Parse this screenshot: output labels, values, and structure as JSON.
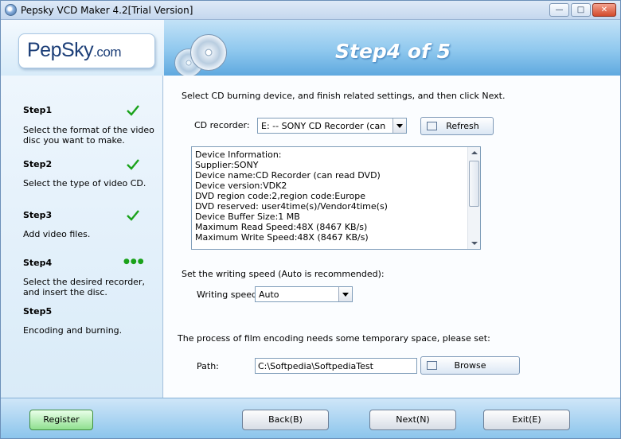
{
  "window": {
    "title": "Pepsky VCD Maker 4.2[Trial Version]"
  },
  "header": {
    "logo_main": "PepSky",
    "logo_suffix": ".com",
    "step_title": "Step4 of 5"
  },
  "sidebar": {
    "steps": [
      {
        "label": "Step1",
        "desc": "Select the format of the video disc you want to make.",
        "status": "done"
      },
      {
        "label": "Step2",
        "desc": "Select the type of video CD.",
        "status": "done"
      },
      {
        "label": "Step3",
        "desc": "Add video files.",
        "status": "done"
      },
      {
        "label": "Step4",
        "desc": "Select the desired recorder, and insert the disc.",
        "status": "current",
        "indicator": "●●●"
      },
      {
        "label": "Step5",
        "desc": "Encoding and burning.",
        "status": "pending"
      }
    ]
  },
  "main": {
    "instruction": "Select CD burning device, and finish related settings, and then click Next.",
    "recorder_label": "CD recorder:",
    "recorder_value": "E:   -- SONY     CD Recorder (can",
    "refresh_label": "Refresh",
    "device_info": [
      "Device Information:",
      "Supplier:SONY",
      "Device name:CD Recorder (can read DVD)",
      "Device version:VDK2",
      "DVD region code:2,region code:Europe",
      "DVD reserved: user4time(s)/Vendor4time(s)",
      "Device Buffer Size:1 MB",
      "Maximum Read Speed:48X   (8467 KB/s)",
      "Maximum Write Speed:48X   (8467 KB/s)"
    ],
    "speed_section": "Set the writing speed (Auto is recommended):",
    "speed_label": "Writing speed:",
    "speed_value": "Auto",
    "temp_section": "The process of film encoding needs some temporary space, please set:",
    "path_label": "Path:",
    "path_value": "C:\\Softpedia\\SoftpediaTest",
    "browse_label": "Browse"
  },
  "footer": {
    "register_label": "Register",
    "back_label": "Back(B)",
    "next_label": "Next(N)",
    "exit_label": "Exit(E)"
  },
  "colors": {
    "check_green": "#1aa21a",
    "header_blue": "#5fa9df",
    "title_text": "#ffffff"
  }
}
